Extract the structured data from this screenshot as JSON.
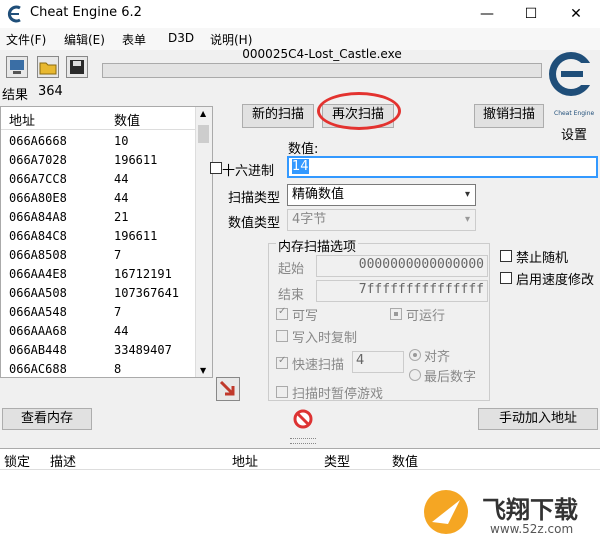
{
  "window": {
    "title": "Cheat Engine 6.2"
  },
  "menu": [
    "文件(F)",
    "编辑(E)",
    "表单",
    "D3D",
    "说明(H)"
  ],
  "process": {
    "name": "000025C4-Lost_Castle.exe"
  },
  "results": {
    "label": "结果",
    "count": "364"
  },
  "list": {
    "headers": [
      "地址",
      "数值"
    ],
    "rows": [
      [
        "066A6668",
        "10"
      ],
      [
        "066A7028",
        "196611"
      ],
      [
        "066A7CC8",
        "44"
      ],
      [
        "066A80E8",
        "44"
      ],
      [
        "066A84A8",
        "21"
      ],
      [
        "066A84C8",
        "196611"
      ],
      [
        "066A8508",
        "7"
      ],
      [
        "066AA4E8",
        "16712191"
      ],
      [
        "066AA508",
        "107367641"
      ],
      [
        "066AA548",
        "7"
      ],
      [
        "066AAA68",
        "44"
      ],
      [
        "066AB448",
        "33489407"
      ],
      [
        "066AC688",
        "8"
      ]
    ]
  },
  "scan": {
    "new_scan": "新的扫描",
    "next_scan": "再次扫描",
    "undo_scan": "撤销扫描",
    "value_label": "数值:",
    "value": "14",
    "hex_label": "十六进制",
    "scan_type_label": "扫描类型",
    "scan_type": "精确数值",
    "value_type_label": "数值类型",
    "value_type": "4字节"
  },
  "memory": {
    "title": "内存扫描选项",
    "start_label": "起始",
    "start": "0000000000000000",
    "end_label": "结束",
    "end": "7fffffffffffffff",
    "writable": "可写",
    "executable": "可运行",
    "copy_on_write": "写入时复制",
    "fast_scan": "快速扫描",
    "fast_value": "4",
    "align": "对齐",
    "last_digits": "最后数字",
    "pause": "扫描时暂停游戏"
  },
  "options": {
    "no_random": "禁止随机",
    "speedhack": "启用速度修改"
  },
  "settings": {
    "label": "设置",
    "logo_text": "Cheat Engine"
  },
  "buttons": {
    "view_memory": "查看内存",
    "add_address": "手动加入地址"
  },
  "table": {
    "headers": [
      "锁定",
      "描述",
      "地址",
      "类型",
      "数值"
    ]
  },
  "watermark": {
    "brand": "飞翔下载",
    "url": "www.52z.com"
  },
  "colors": {
    "accent_red": "#e3322f",
    "highlight": "#3399ff",
    "logo_blue": "#1f4e79"
  }
}
